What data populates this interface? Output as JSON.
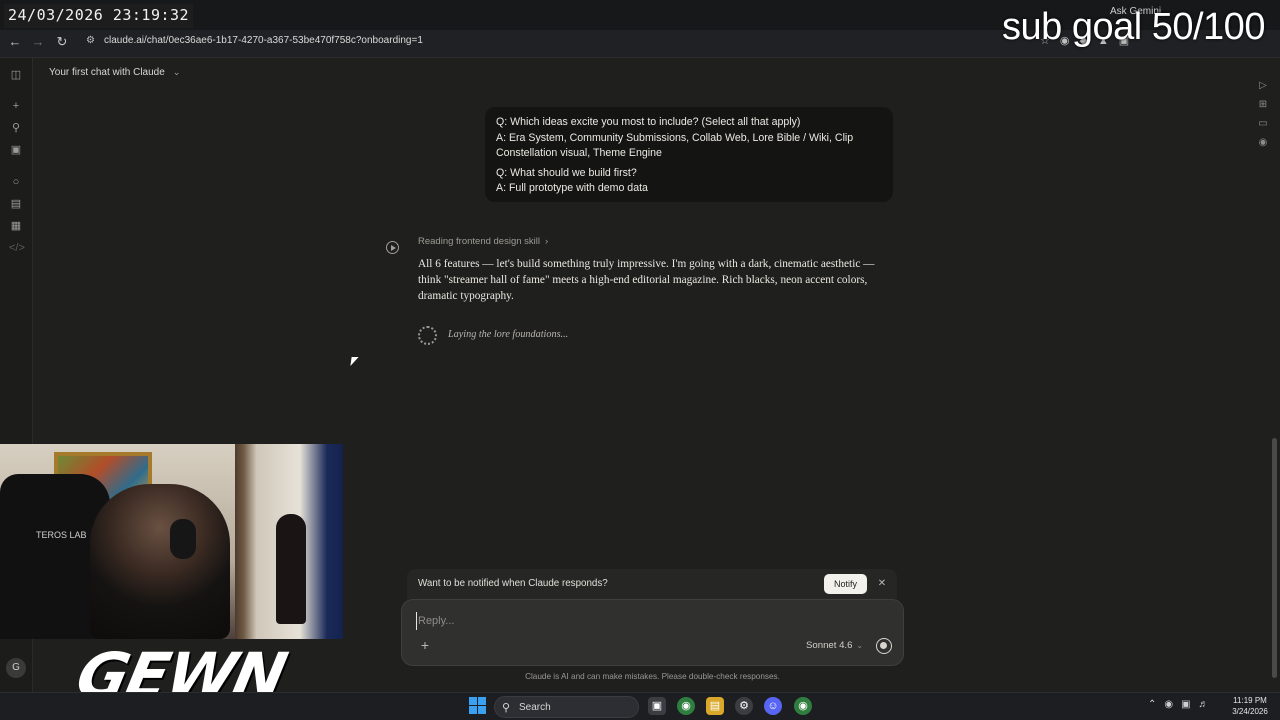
{
  "overlay": {
    "timestamp": "24/03/2026 23:19:32",
    "subgoal": "sub goal 50/100",
    "brand": "GEWN"
  },
  "browser": {
    "url": "claude.ai/chat/0ec36ae6-1b17-4270-a367-53be470f758c?onboarding=1",
    "ask_gemini": "Ask Gemini"
  },
  "header": {
    "chat_title": "Your first chat with Claude"
  },
  "user_message": {
    "lines": [
      "Q: Which ideas excite you most to include? (Select all that apply)",
      "A: Era System, Community Submissions, Collab Web, Lore Bible / Wiki, Clip Constellation visual, Theme Engine",
      "Q: What should we build first?",
      "A: Full prototype with demo data"
    ]
  },
  "assistant": {
    "skill_label": "Reading frontend design skill",
    "text": "All 6 features — let's build something truly impressive. I'm going with a dark, cinematic aesthetic — think \"streamer hall of fame\" meets a high-end editorial magazine. Rich blacks, neon accent colors, dramatic typography.",
    "status": "Laying the lore foundations..."
  },
  "notify": {
    "question": "Want to be notified when Claude responds?",
    "button": "Notify"
  },
  "composer": {
    "placeholder": "Reply...",
    "model": "Sonnet 4.6"
  },
  "disclaimer": "Claude is AI and can make mistakes. Please double-check responses.",
  "sidebar": {
    "avatar_initial": "G"
  },
  "webcam": {
    "chair_logo": "TEROS LAB"
  },
  "taskbar": {
    "search_label": "Search",
    "time": "11:19 PM",
    "date": "3/24/2026"
  },
  "colors": {
    "background": "#1f1f1e",
    "bubble": "#141413",
    "composer": "#30302e",
    "taskbar": "#1c1e22"
  }
}
